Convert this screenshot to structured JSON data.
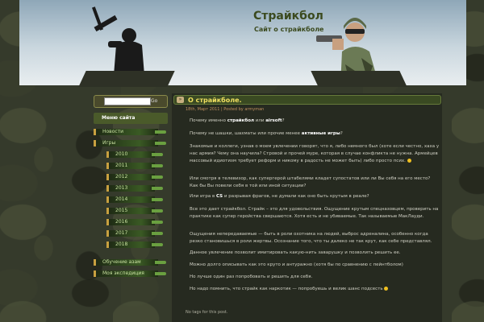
{
  "header": {
    "title": "Страйкбол",
    "description": "Сайт о страйкболе"
  },
  "search": {
    "value": "",
    "button": "Go"
  },
  "sidebar": {
    "menu_header": "Меню сайта",
    "items_top": [
      "Новости",
      "Игры"
    ],
    "years": [
      "2010",
      "2011",
      "2012",
      "2013",
      "2014",
      "2015",
      "2016",
      "2017",
      "2018"
    ],
    "items_bottom": [
      "Обучение азам",
      "Моя экспедиция"
    ]
  },
  "post": {
    "title": "О страйкболе.",
    "meta": "18th, Март 2011 | Posted by armyman",
    "paragraphs": [
      {
        "pre": "Почему именно ",
        "bold": "страйкбол",
        "mid": " или ",
        "bold2": "airsoft",
        "post": "?"
      },
      {
        "pre": "Почему не шашки, шахматы или прочие менее ",
        "bold": "активные игры",
        "mid": "",
        "bold2": "",
        "post": "?"
      },
      {
        "pre": "Знакомые и коллеги, узнав о моем увлечении говорят, что я, либо немного был (хоте если честно, хаха у нас армия? Чему она научила? Стровой и прочей муре, которая в случае конфликта не нужна. Армейцев массовый идиотизм требует реформ и никому в радость не может быть) либо просто псих.",
        "bold": "",
        "mid": "",
        "bold2": "",
        "post": ""
      },
      {
        "pre": "Или смотря в телевизор, как супергерой штабелями кладет супостатов или ли Вы себя на его место? Как бы Вы повели себя в той или иной ситуации?",
        "bold": "",
        "mid": "",
        "bold2": "",
        "post": ""
      },
      {
        "pre": "Или игра в ",
        "bold": "CS",
        "mid": " и разрывая фрагов, не думали как оно быть крутым в реале?",
        "bold2": "",
        "post": ""
      },
      {
        "pre": "Все это дает страйкбол. Страйк – это для удовольствия. Ощущение крутым спецназовцем, проверить на практике как супер геройства свершаются. Хотя есть и не убиваемые. Так называемые МакЛауди.",
        "bold": "",
        "mid": "",
        "bold2": "",
        "post": ""
      },
      {
        "pre": "Ощущения непередаваемые — быть в роли охотника на людей, выброс адреналина, особенно когда резко становишься в роли жертвы. Осознание того, что ты далеко не так крут, как себе представлял.",
        "bold": "",
        "mid": "",
        "bold2": "",
        "post": ""
      },
      {
        "pre": "Данное увлечение позволит имитировать какую-нить заварушку и позволить решить ее.",
        "bold": "",
        "mid": "",
        "bold2": "",
        "post": ""
      },
      {
        "pre": "Можно долго описывать как это круто и антуражно (хотя бы по сравнению с пейнтболом)",
        "bold": "",
        "mid": "",
        "bold2": "",
        "post": ""
      },
      {
        "pre": "Но лучше один раз попробовать и решить для себя.",
        "bold": "",
        "mid": "",
        "bold2": "",
        "post": ""
      },
      {
        "pre": "Но надо помнить, что страйк как наркотик — попробуешь и велик шанс подсесть",
        "bold": "",
        "mid": "",
        "bold2": "",
        "post": ""
      }
    ],
    "tags": "No tags for this post."
  },
  "colors": {
    "title": "#3b4a1e",
    "post_title": "#f0e060",
    "accent_green": "#4a5a2a"
  }
}
